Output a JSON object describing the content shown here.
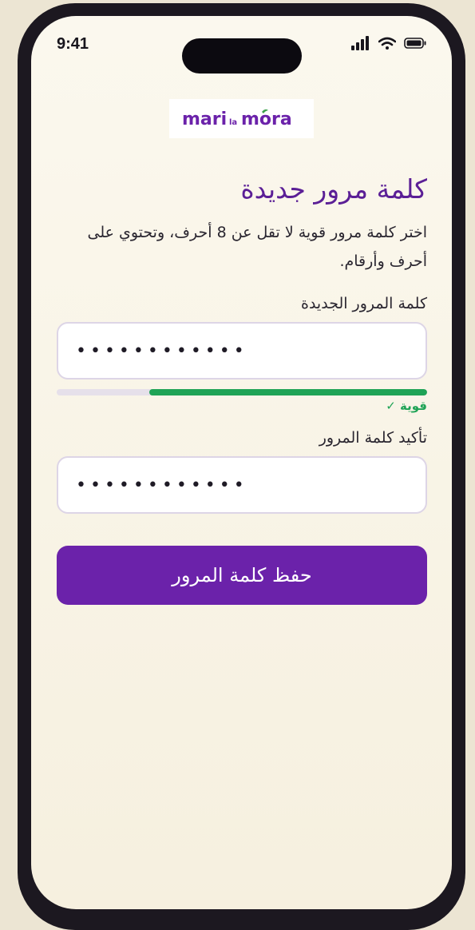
{
  "status_bar": {
    "time": "9:41"
  },
  "logo": {
    "word1": "mari",
    "word2": "la",
    "word3": "mora",
    "color": "#6b22aa"
  },
  "page": {
    "title": "كلمة مرور جديدة",
    "subtitle": "اختر كلمة مرور قوية لا تقل عن 8 أحرف، وتحتوي على أحرف وأرقام."
  },
  "new_password": {
    "label": "كلمة المرور الجديدة",
    "value": "••••••••••••"
  },
  "strength": {
    "fraction": 0.75,
    "label": "قوية ✓",
    "color": "#1fa356"
  },
  "confirm_password": {
    "label": "تأكيد كلمة المرور",
    "value": "••••••••••••"
  },
  "save_button": {
    "label": "حفظ كلمة المرور",
    "color": "#6b22aa"
  }
}
